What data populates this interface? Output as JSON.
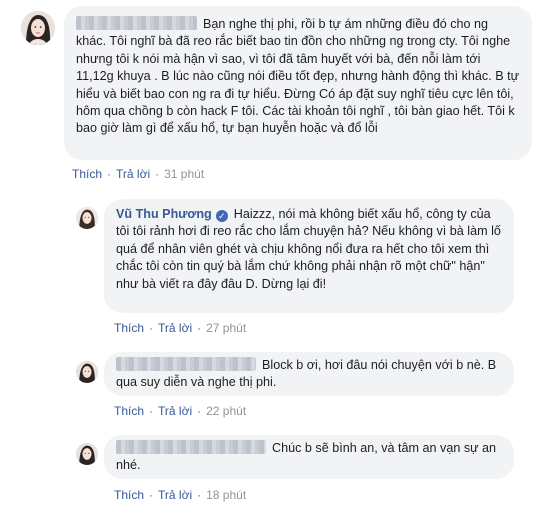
{
  "comments": [
    {
      "author": "",
      "text": "Bạn nghe thị phi, rồi b tự ám những điều đó cho ng khác. Tôi nghĩ bà đã reo rắc biết bao tin đồn cho những ng trong cty. Tôi nghe nhưng tôi k nói mà hận vì sao, vì tôi đã tâm huyết với bà, đến nỗi làm tới 11,12g khuya . B lúc nào cũng nói điều tốt đẹp, nhưng hành động thì khác. B tự hiểu và biết bao con ng ra đi tự hiểu. Đừng Có áp đặt suy nghĩ tiêu cực lên tôi, hôm qua chồng b còn hack F tôi. Các tài khoản tôi nghĩ , tôi bàn giao hết. Tôi k bao giờ làm gì để xấu hổ, tự bạn huyễn hoặc và đổ lỗi",
      "like_label": "Thích",
      "reply_label": "Trả lời",
      "time": "31 phút"
    },
    {
      "author": "Vũ Thu Phương",
      "text": "Haizzz, nói mà không biết xấu hổ, công ty của tôi tôi rảnh hơi đi reo rắc cho lắm chuyện hả? Nếu không vì bà làm lố quá để nhân viên ghét và chịu không nổi đưa ra hết cho tôi xem thì chắc tôi còn tin quý bà lắm chứ không phải nhận rõ một chữ\" hận\" như bà viết ra đây đâu D. Dừng lại đi!",
      "like_label": "Thích",
      "reply_label": "Trả lời",
      "time": "27 phút"
    },
    {
      "author": "",
      "text": "Block b ơi, hơi đâu nói chuyện với b nè. B qua suy diễn và nghe thị phi.",
      "like_label": "Thích",
      "reply_label": "Trả lời",
      "time": "22 phút"
    },
    {
      "author": "",
      "text": "Chúc b sẽ bình an, và tâm an vạn sự an nhé.",
      "like_label": "Thích",
      "reply_label": "Trả lời",
      "time": "18 phút"
    }
  ],
  "colors": {
    "bubble": "#f2f3f5",
    "link": "#385898",
    "meta": "#90949c",
    "verified": "#4267b2"
  },
  "icons": {
    "verified": "verified-badge-icon",
    "avatar_a": "female-avatar-icon",
    "avatar_b": "female-avatar-icon"
  }
}
